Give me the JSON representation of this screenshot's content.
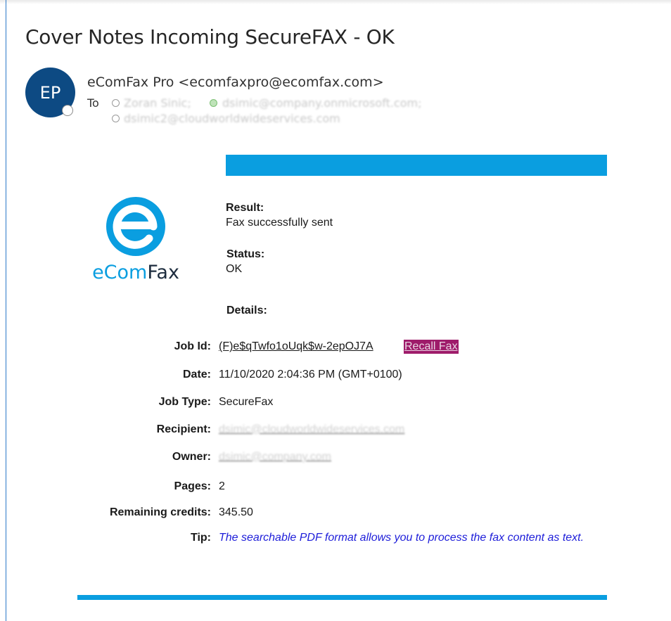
{
  "email": {
    "subject": "Cover Notes Incoming SecureFAX - OK",
    "avatar_initials": "EP",
    "sender": "eComFax Pro <ecomfaxpro@ecomfax.com>",
    "to_label": "To",
    "recipients": [
      "Zoran Sinic;",
      "dsimic@company.onmicrosoft.com;",
      "dsimic2@cloudworldwideservices.com"
    ]
  },
  "logo": {
    "part1": "eCom",
    "part2": "Fax",
    "accent": "#0a9ee0",
    "dark": "#1e2d3f"
  },
  "body": {
    "result_label": "Result:",
    "result_value": "Fax successfully sent",
    "status_label": "Status:",
    "status_value": "OK",
    "details_label": "Details:",
    "fields": {
      "job_id_label": "Job Id:",
      "job_id_value": "(F)e$qTwfo1oUqk$w-2epOJ7A",
      "recall_label": "Recall Fax",
      "date_label": "Date:",
      "date_value": "11/10/2020 2:04:36 PM (GMT+0100)",
      "job_type_label": "Job Type:",
      "job_type_value": "SecureFax",
      "recipient_label": "Recipient:",
      "recipient_value": "dsimic@cloudworldwideservices.com",
      "owner_label": "Owner:",
      "owner_value": "dsimic@company.com",
      "pages_label": "Pages:",
      "pages_value": "2",
      "credits_label": "Remaining credits:",
      "credits_value": "345.50",
      "tip_label": "Tip:",
      "tip_value": "The searchable PDF format allows you to process the fax content as text."
    }
  },
  "colors": {
    "banner": "#0a9ee0",
    "recall_bg": "#9e1b6a",
    "tip_text": "#1d1dd9",
    "avatar_bg": "#0d4a83"
  }
}
